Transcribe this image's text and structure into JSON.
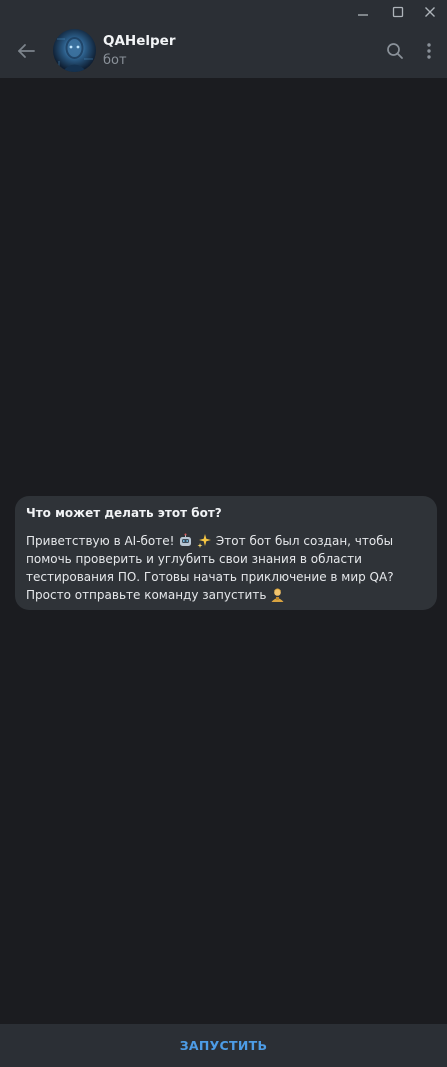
{
  "window": {
    "controls": [
      "minimize-icon",
      "maximize-icon",
      "close-icon"
    ]
  },
  "header": {
    "title": "QAHelper",
    "subtitle": "бот",
    "icons": [
      "back-arrow-icon",
      "search-icon",
      "more-vertical-icon"
    ]
  },
  "intro": {
    "title": "Что может делать этот бот?",
    "line1_a": "Приветствую  в  AI-боте! ",
    "line1_b": " Этот бот был создан, чтобы",
    "line2": "помочь  проверить и углубить свои знания в области",
    "line3": "тестирования ПО. Готовы начать  приключение в мир QA?",
    "line4": "Просто отправьте команду запустить ",
    "emojis": [
      "robot-emoji",
      "sparkles-emoji",
      "person-emoji"
    ]
  },
  "footer": {
    "start_label": "ЗАПУСТИТЬ"
  },
  "colors": {
    "background": "#1b1c20",
    "header": "#2b2f35",
    "bubble": "#2f3338",
    "accent": "#4d9ce6"
  }
}
